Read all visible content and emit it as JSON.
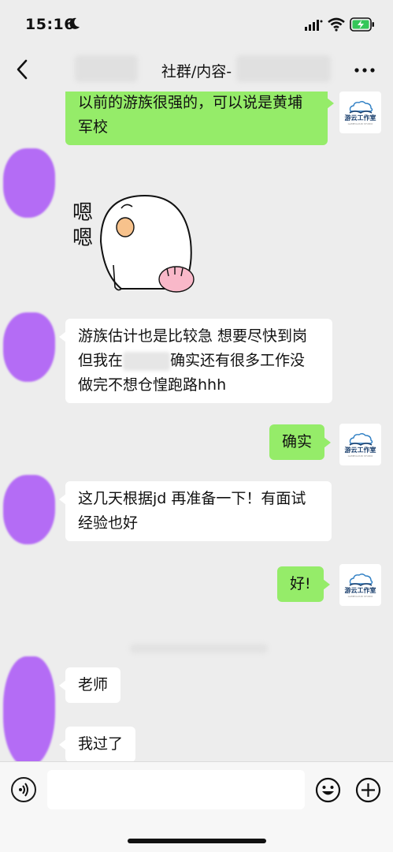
{
  "status": {
    "time": "15:16"
  },
  "nav": {
    "title": "社群/内容-",
    "more_icon": "more-dots-icon",
    "back_icon": "chevron-left-icon"
  },
  "messages": [
    {
      "from": "me",
      "text": "以前的游族很强的，可以说是黄埔军校"
    },
    {
      "from": "them",
      "type": "sticker",
      "sticker_text": "嗯\n嗯"
    },
    {
      "from": "them",
      "text_before": "游族估计也是比较急 想要尽快到岗 但我在",
      "text_after": "确实还有很多工作没做完不想仓惶跑路hhh"
    },
    {
      "from": "me",
      "text": "确实"
    },
    {
      "from": "them",
      "text": "这几天根据jd 再准备一下！有面试经验也好"
    },
    {
      "from": "me",
      "text": "好!"
    },
    {
      "from": "them",
      "text": "老师"
    },
    {
      "from": "them",
      "text": "我过了"
    }
  ],
  "avatar_me": {
    "logo_text": "游云工作室",
    "logo_sub": "GAMECLOUD STUDIO"
  },
  "input": {
    "placeholder": "",
    "value": ""
  },
  "colors": {
    "my_bubble": "#95ec69",
    "their_bubble": "#ffffff",
    "background": "#ededed",
    "avatar_blur": "#b46cf5"
  }
}
